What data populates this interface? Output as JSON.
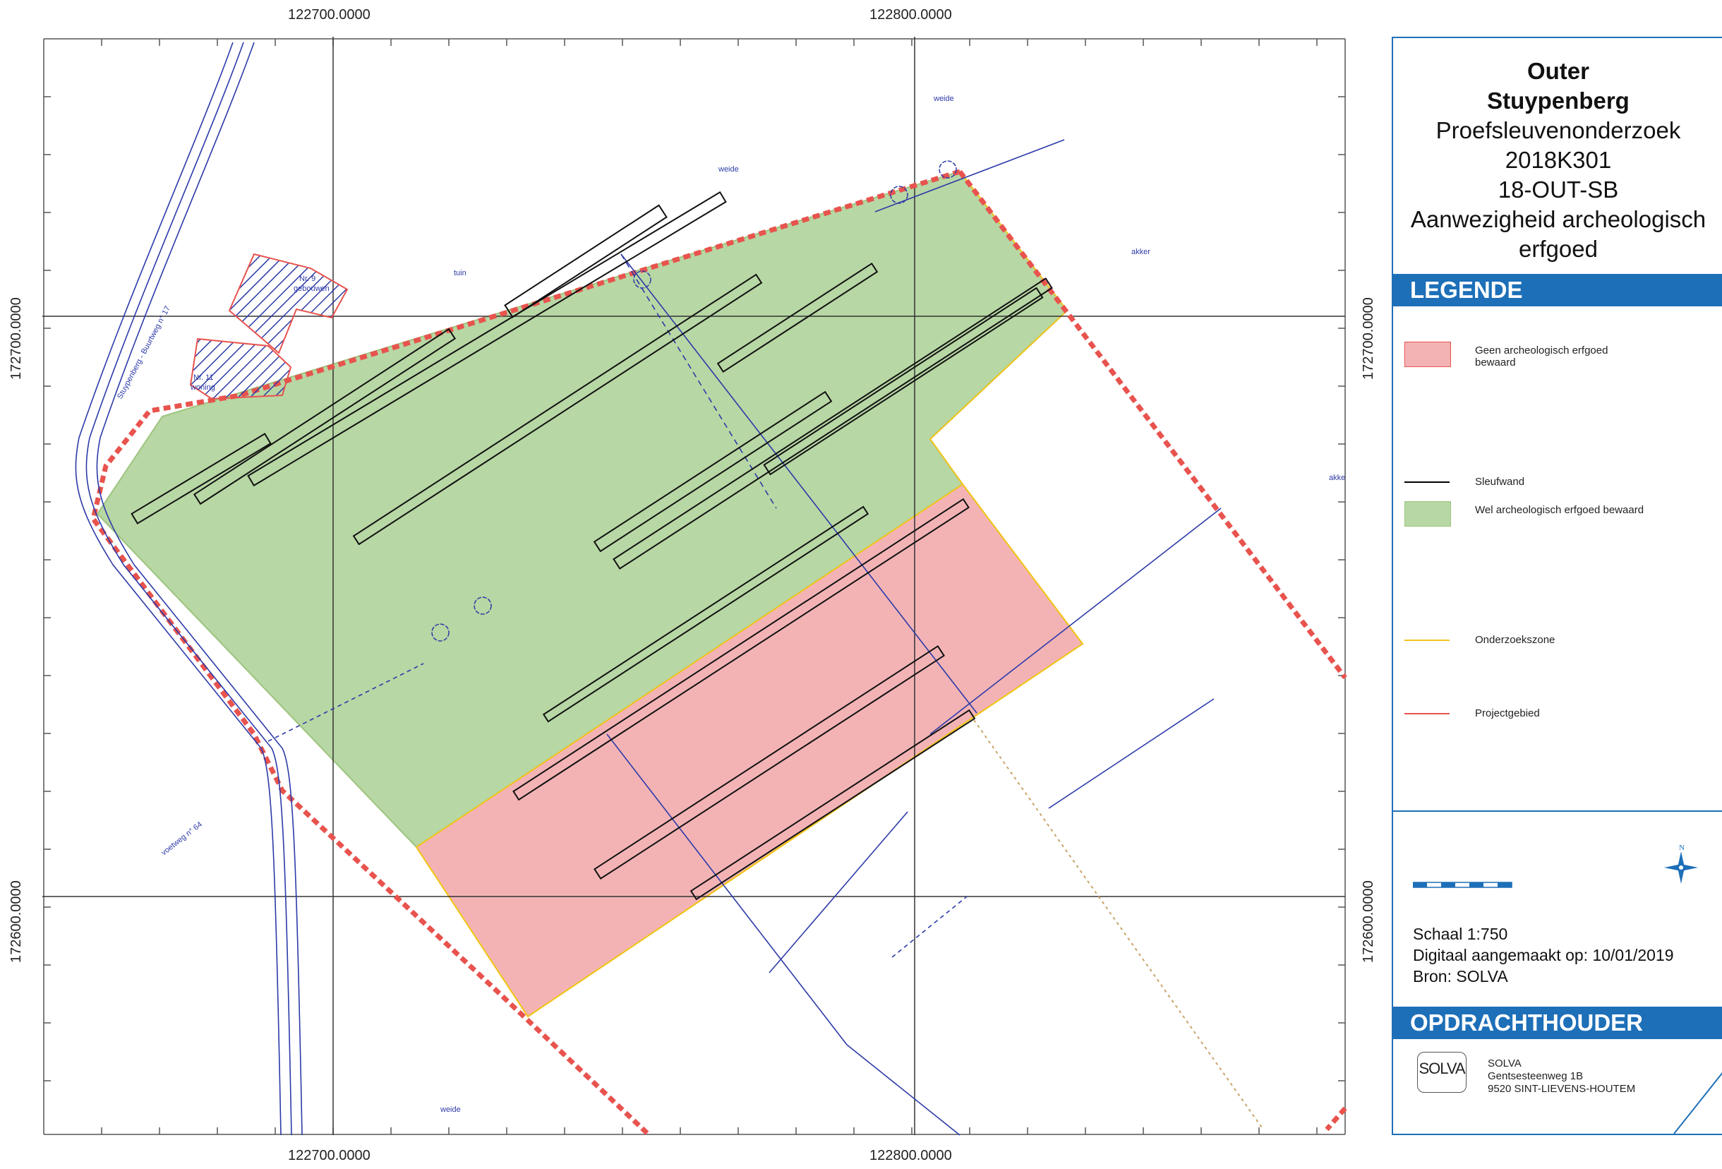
{
  "map": {
    "grid_labels": {
      "x_top_left": "122700.0000",
      "x_top_right": "122800.0000",
      "x_bottom_left": "122700.0000",
      "x_bottom_right": "122800.0000",
      "y_left_upper": "172700.0000",
      "y_left_lower": "172600.0000",
      "y_right_upper": "172700.0000",
      "y_right_lower": "172600.0000"
    },
    "annotations": {
      "weide_top": "weide",
      "weide_mid": "weide",
      "weide_bottom": "weide",
      "tuin": "tuin",
      "akker_top": "akker",
      "akker_right": "akke",
      "street": "Stuypenberg - Buurtweg n° 17",
      "voetweg": "voetweg n° 64",
      "nr9": "Nr. 9",
      "gebouwen": "gebouwen",
      "nr11": "Nr. 11",
      "woning": "woning"
    },
    "colors": {
      "green_zone": "#b7d7a4",
      "red_zone": "#f3b3b5",
      "project_border": "#e8534e",
      "research_zone_border": "#f0c419",
      "grid": "#333333",
      "blue_lines": "#2c3aa8"
    }
  },
  "panel": {
    "title_line1": "Outer",
    "title_line2": "Stuypenberg",
    "title_line3": "Proefsleuvenonderzoek",
    "title_line4": "2018K301",
    "title_line5": "18-OUT-SB",
    "title_line6": "Aanwezigheid archeologisch",
    "title_line7": "erfgoed",
    "legend_header": "LEGENDE",
    "legend": [
      {
        "label": "Geen archeologisch erfgoed bewaard",
        "symbol": "red-fill",
        "color": "#f3b3b5"
      },
      {
        "label": "Sleufwand",
        "symbol": "black-line",
        "color": "#000000"
      },
      {
        "label": "Wel archeologisch erfgoed bewaard",
        "symbol": "green-fill",
        "color": "#b7d7a4"
      },
      {
        "label": "Onderzoekszone",
        "symbol": "yellow-line",
        "color": "#f0c419"
      },
      {
        "label": "Projectgebied",
        "symbol": "red-line",
        "color": "#e8534e"
      }
    ],
    "scale_text": "Schaal 1:750",
    "date_text": "Digitaal aangemaakt op: 10/01/2019",
    "source_text": "Bron: SOLVA",
    "client_header": "OPDRACHTHOUDER",
    "client_logo_text": "SOLVA",
    "client_name": "SOLVA",
    "client_address1": "Gentsesteenweg 1B",
    "client_address2": "9520 SINT-LIEVENS-HOUTEM",
    "north_letter": "N"
  }
}
